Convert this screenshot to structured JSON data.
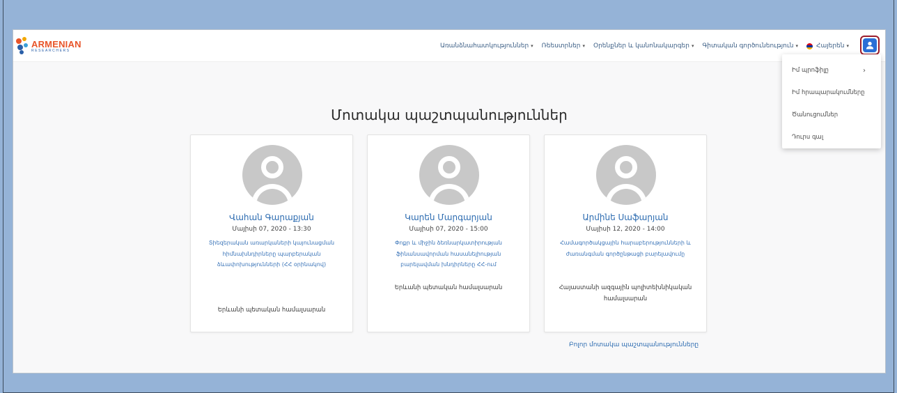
{
  "logo": {
    "main": "ARMENIAN",
    "sub": "RESEARCHERS"
  },
  "nav": {
    "items": [
      {
        "label": "Առանձնահատկություններ"
      },
      {
        "label": "Ռեեստրներ"
      },
      {
        "label": "Օրենքներ և կանոնակարգեր"
      },
      {
        "label": "Գիտական գործունեություն"
      }
    ],
    "language": "Հայերեն"
  },
  "user_menu": {
    "items": [
      "Իմ պրոֆիլը",
      "Իմ հրապարակումները",
      "Ծանուցումներ",
      "Դուրս գալ"
    ]
  },
  "page": {
    "title": "Մոտակա պաշտպանություններ"
  },
  "cards": [
    {
      "name": "Վահան Գարաքյան",
      "date": "Մայիսի 07, 2020 - 13:30",
      "topic": "Տիեզերական առարկաների կայունացման հիմնախնդիրները պարբերական ձևափոխությունների (ՀՀ օրինակով)",
      "institution": "Երևանի պետական համալսարան"
    },
    {
      "name": "Կարեն Մարգարյան",
      "date": "Մայիսի 07, 2020 - 15:00",
      "topic": "Փոքր և միջին ձեռնարկատիրության ֆինանսավորման հասանելիության բարելավման խնդիրները ՀՀ-ում",
      "institution": "Երևանի պետական համալսարան"
    },
    {
      "name": "Արմինե Սաֆարյան",
      "date": "Մայիսի 12, 2020 - 14:00",
      "topic": "Համագործակցային հարաբերությունների և ժառանգման գործընթացի բարելավումը",
      "institution": "Հայաստանի ազգային պոլիտեխնիկական համալսարան"
    }
  ],
  "all_link": "Բոլոր մոտակա պաշտպանությունները",
  "colors": {
    "link": "#2c6bb0",
    "accent_border": "#9b1b2a",
    "user_icon": "#2a6fd6",
    "backdrop": "#95b3d7"
  }
}
